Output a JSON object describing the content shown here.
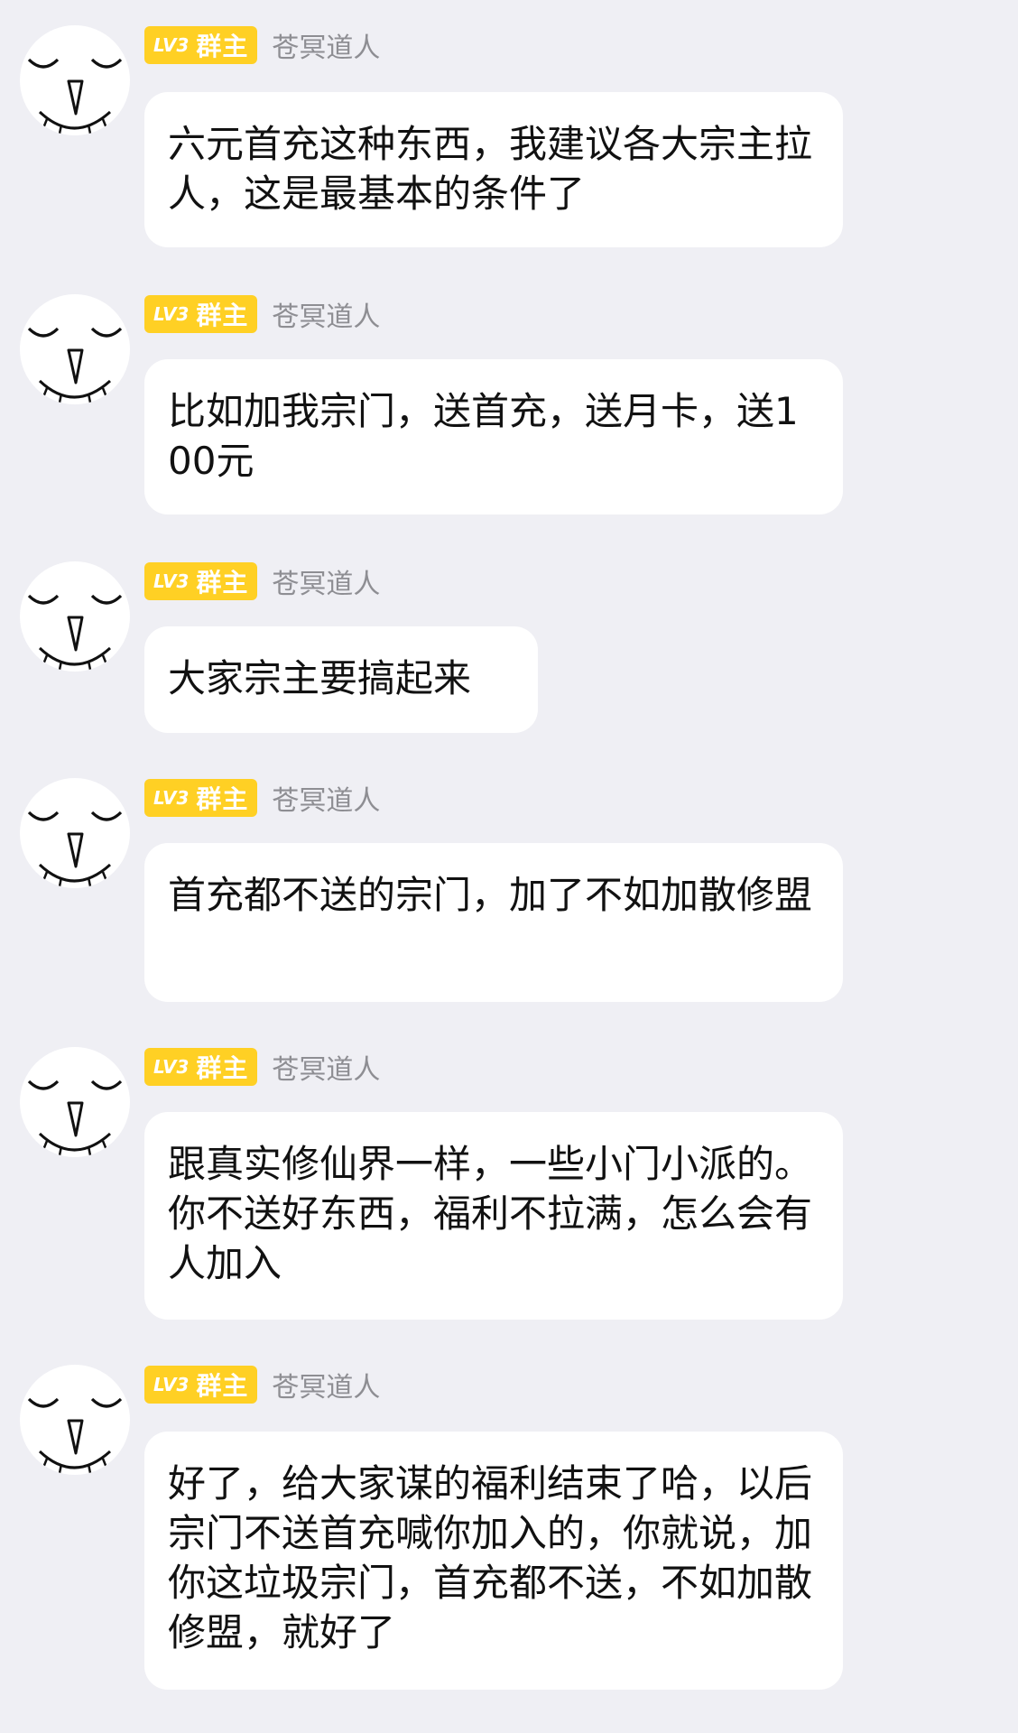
{
  "messages": [
    {
      "badge_level": "LV3",
      "badge_role": "群主",
      "sender": "苍冥道人",
      "text": "六元首充这种东西，我建议各大宗主拉人，这是最基本的条件了"
    },
    {
      "badge_level": "LV3",
      "badge_role": "群主",
      "sender": "苍冥道人",
      "text": "比如加我宗门，送首充，送月卡，送100元"
    },
    {
      "badge_level": "LV3",
      "badge_role": "群主",
      "sender": "苍冥道人",
      "text": "大家宗主要搞起来"
    },
    {
      "badge_level": "LV3",
      "badge_role": "群主",
      "sender": "苍冥道人",
      "text": "首充都不送的宗门，加了不如加散修盟"
    },
    {
      "badge_level": "LV3",
      "badge_role": "群主",
      "sender": "苍冥道人",
      "text": "跟真实修仙界一样，一些小门小派的。你不送好东西，福利不拉满，怎么会有人加入"
    },
    {
      "badge_level": "LV3",
      "badge_role": "群主",
      "sender": "苍冥道人",
      "text": "好了，给大家谋的福利结束了哈，以后宗门不送首充喊你加入的，你就说，加你这垃圾宗门，首充都不送，不如加散修盟，就好了"
    }
  ],
  "colors": {
    "background": "#efeff4",
    "bubble": "#ffffff",
    "badge": "#ffd024",
    "sender_name": "#8e8e93",
    "text": "#111111"
  },
  "icons": {
    "avatar": "sleepy-face-avatar-icon"
  }
}
